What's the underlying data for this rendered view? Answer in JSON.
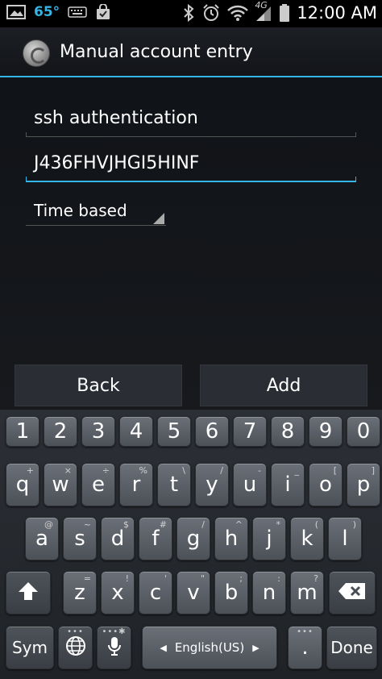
{
  "status_bar": {
    "temperature": "65°",
    "network": "4G",
    "time": "12:00 AM"
  },
  "action_bar": {
    "title": "Manual account entry",
    "accent_color": "#33b5e5"
  },
  "form": {
    "account_name": "ssh authentication",
    "key": "J436FHVJHGI5HINF",
    "type_selected": "Time based"
  },
  "buttons": {
    "back": "Back",
    "add": "Add"
  },
  "keyboard": {
    "numbers": [
      "1",
      "2",
      "3",
      "4",
      "5",
      "6",
      "7",
      "8",
      "9",
      "0"
    ],
    "row1": [
      {
        "key": "q",
        "sub": "+"
      },
      {
        "key": "w",
        "sub": "×"
      },
      {
        "key": "e",
        "sub": "÷"
      },
      {
        "key": "r",
        "sub": "%"
      },
      {
        "key": "t",
        "sub": "\\"
      },
      {
        "key": "y",
        "sub": "/"
      },
      {
        "key": "u",
        "sub": "-"
      },
      {
        "key": "i",
        "sub": "_"
      },
      {
        "key": "o",
        "sub": "["
      },
      {
        "key": "p",
        "sub": "]"
      }
    ],
    "row2": [
      {
        "key": "a",
        "sub": "@"
      },
      {
        "key": "s",
        "sub": "~"
      },
      {
        "key": "d",
        "sub": "$"
      },
      {
        "key": "f",
        "sub": "#"
      },
      {
        "key": "g",
        "sub": "/"
      },
      {
        "key": "h",
        "sub": "^"
      },
      {
        "key": "j",
        "sub": "*"
      },
      {
        "key": "k",
        "sub": "("
      },
      {
        "key": "l",
        "sub": ")"
      }
    ],
    "row3": [
      {
        "key": "z",
        "sub": "="
      },
      {
        "key": "x",
        "sub": "!"
      },
      {
        "key": "c",
        "sub": "'"
      },
      {
        "key": "v",
        "sub": "\""
      },
      {
        "key": "b",
        "sub": ";"
      },
      {
        "key": "n",
        "sub": ":"
      },
      {
        "key": "m",
        "sub": "?"
      }
    ],
    "sym_label": "Sym",
    "space_label": "English(US)",
    "period": ".",
    "done_label": "Done"
  }
}
